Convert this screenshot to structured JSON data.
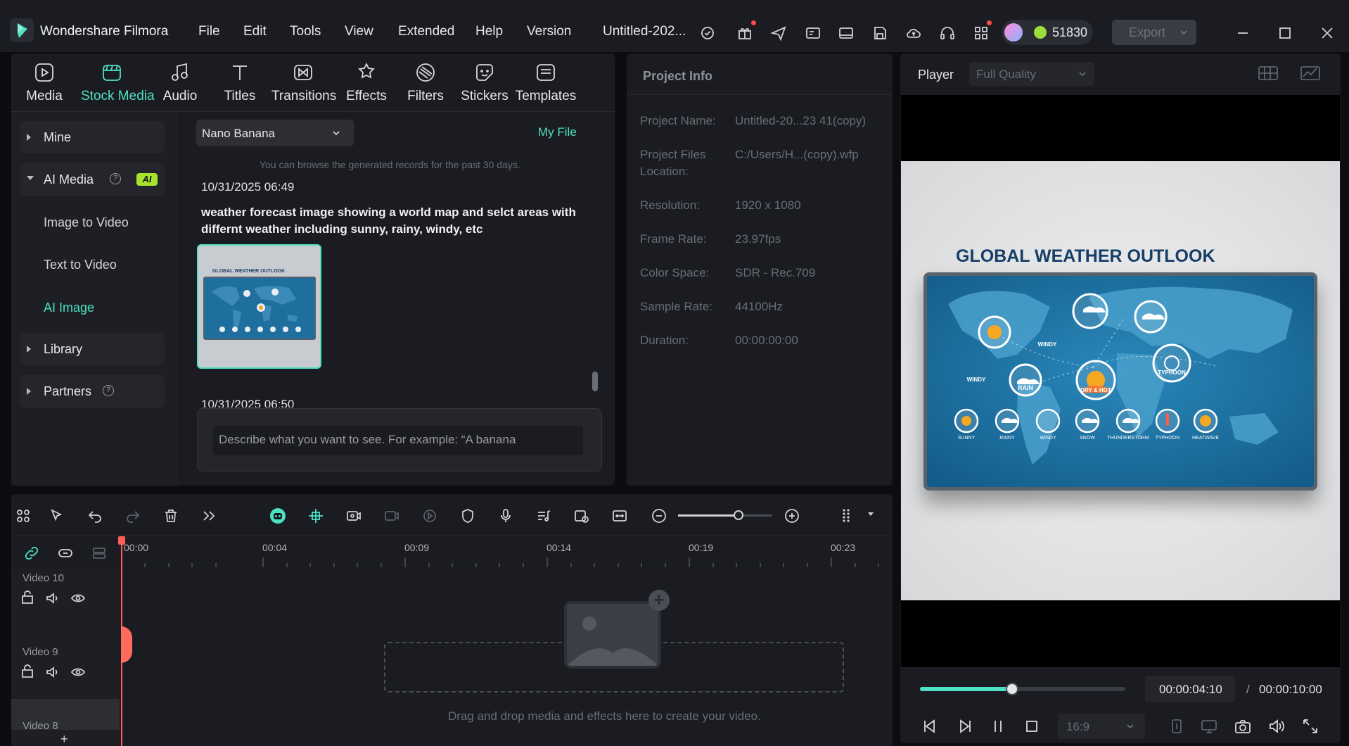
{
  "app": {
    "title": "Wondershare Filmora",
    "menu": [
      "File",
      "Edit",
      "Tools",
      "View",
      "Extended",
      "Help",
      "Version"
    ],
    "project_title": "Untitled-202...",
    "credits": "51830",
    "export_label": "Export"
  },
  "toolbar": {
    "tabs": [
      {
        "label": "Media",
        "icon": "media-icon"
      },
      {
        "label": "Stock Media",
        "icon": "stock-media-icon"
      },
      {
        "label": "Audio",
        "icon": "audio-icon"
      },
      {
        "label": "Titles",
        "icon": "titles-icon"
      },
      {
        "label": "Transitions",
        "icon": "transitions-icon"
      },
      {
        "label": "Effects",
        "icon": "effects-icon"
      },
      {
        "label": "Filters",
        "icon": "filters-icon"
      },
      {
        "label": "Stickers",
        "icon": "stickers-icon"
      },
      {
        "label": "Templates",
        "icon": "templates-icon"
      }
    ],
    "active_index": 1
  },
  "sidebar": {
    "mine": "Mine",
    "ai_media": "AI Media",
    "ai_badge": "AI",
    "sub_items": [
      "Image to Video",
      "Text to Video",
      "AI Image"
    ],
    "library": "Library",
    "partners": "Partners"
  },
  "browser": {
    "model_select": "Nano Banana",
    "my_file": "My File",
    "hint": "You can browse the generated records for the past 30 days.",
    "record1_time": "10/31/2025 06:49",
    "record1_prompt_line1": "weather forecast image showing a world map and selct areas with",
    "record1_prompt_line2": "differnt weather including sunny, rainy, windy, etc",
    "record2_time": "10/31/2025 06:50",
    "prompt_placeholder": "Describe what you want to see. For example: “A banana"
  },
  "project_info": {
    "heading": "Project Info",
    "rows": [
      {
        "label": "Project Name:",
        "value": "Untitled-20...23 41(copy)"
      },
      {
        "label": "Project Files",
        "label2": "Location:",
        "value": "C:/Users/H...(copy).wfp"
      },
      {
        "label": "Resolution:",
        "value": "1920 x 1080"
      },
      {
        "label": "Frame Rate:",
        "value": "23.97fps"
      },
      {
        "label": "Color Space:",
        "value": "SDR - Rec.709"
      },
      {
        "label": "Sample Rate:",
        "value": "44100Hz"
      },
      {
        "label": "Duration:",
        "value": "00:00:00:00"
      }
    ]
  },
  "player": {
    "label": "Player",
    "quality": "Full Quality",
    "preview_title": "GLOBAL WEATHER OUTLOOK",
    "thumb_title": "GLOBAL WEATHER OUTLOOK",
    "current_time": "00:00:04:10",
    "separator": "/",
    "total_time": "00:00:10:00",
    "aspect": "16:9",
    "progress": 0.45,
    "map_labels": [
      "SUNNY",
      "RAINY",
      "WINDY",
      "SNOW",
      "THUNDERSTORM",
      "TYPHOON",
      "HEATWAVE"
    ],
    "callouts": [
      "WINDY",
      "WINDY",
      "RAIN",
      "DRY & HOT",
      "TYPHOON"
    ]
  },
  "timeline": {
    "ruler": [
      "00:00",
      "00:04",
      "00:09",
      "00:14",
      "00:19",
      "00:23"
    ],
    "tracks": [
      "Video 10",
      "Video 9",
      "Video 8"
    ],
    "drop_hint": "Drag and drop media and effects here to create your video."
  }
}
